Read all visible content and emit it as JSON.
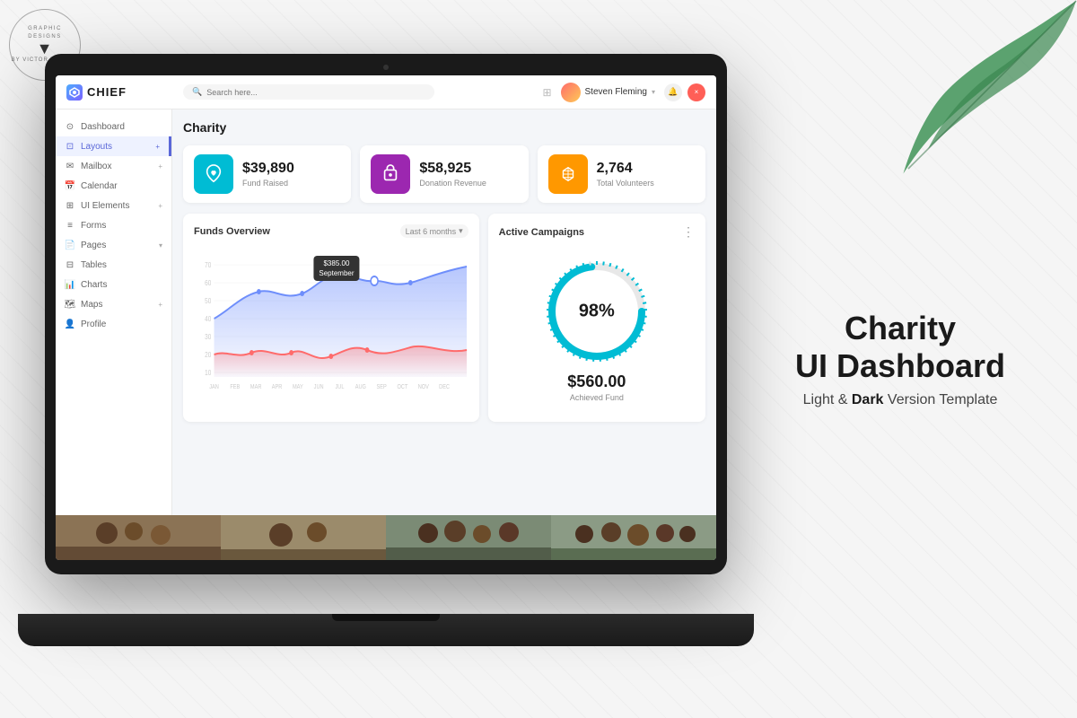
{
  "watermark": {
    "line1": "GRAPHIC DESIGNS",
    "line2": "BY VICTOR THEMES"
  },
  "right_panel": {
    "title1": "Charity",
    "title2": "UI Dashboard",
    "subtitle": "Light & Dark Version Template"
  },
  "topbar": {
    "logo": "CHIEF",
    "search_placeholder": "Search here...",
    "user_name": "Steven Fleming",
    "notification_icon": "🔔",
    "grid_icon": "⊞"
  },
  "sidebar": {
    "items": [
      {
        "label": "Dashboard",
        "icon": "⊙",
        "active": false
      },
      {
        "label": "Layouts",
        "icon": "⊡",
        "active": true,
        "has_arrow": true
      },
      {
        "label": "Mailbox",
        "icon": "✉",
        "active": false,
        "has_arrow": true
      },
      {
        "label": "Calendar",
        "icon": "📅",
        "active": false
      },
      {
        "label": "UI Elements",
        "icon": "⊞",
        "active": false,
        "has_arrow": true
      },
      {
        "label": "Forms",
        "icon": "≡",
        "active": false
      },
      {
        "label": "Pages",
        "icon": "📄",
        "active": false,
        "has_arrow": true
      },
      {
        "label": "Tables",
        "icon": "⊟",
        "active": false
      },
      {
        "label": "Charts",
        "icon": "📊",
        "active": false
      },
      {
        "label": "Maps",
        "icon": "🗺",
        "active": false,
        "has_arrow": true
      },
      {
        "label": "Profile",
        "icon": "👤",
        "active": false
      }
    ]
  },
  "page": {
    "title": "Charity"
  },
  "stats": [
    {
      "value": "$39,890",
      "label": "Fund Raised",
      "icon": "🤲",
      "color_class": "cyan"
    },
    {
      "value": "$58,925",
      "label": "Donation Revenue",
      "icon": "🎁",
      "color_class": "purple"
    },
    {
      "value": "2,764",
      "label": "Total Volunteers",
      "icon": "👥",
      "color_class": "orange"
    }
  ],
  "funds_chart": {
    "title": "Funds Overview",
    "filter": "Last 6 months",
    "tooltip_value": "$385.00",
    "tooltip_month": "September",
    "x_labels": [
      "JAN",
      "FEB",
      "MAR",
      "APR",
      "MAY",
      "JUN",
      "JUL",
      "AUG",
      "SEP",
      "OCT",
      "NOV",
      "DEC"
    ],
    "y_labels": [
      "70",
      "60",
      "50",
      "40",
      "30",
      "20",
      "10"
    ]
  },
  "campaigns_chart": {
    "title": "Active Campaigns",
    "percent": "98%",
    "achieved_value": "$560.00",
    "achieved_label": "Achieved Fund"
  },
  "photos": [
    {
      "alt": "children photo 1"
    },
    {
      "alt": "children photo 2"
    },
    {
      "alt": "children photo 3"
    },
    {
      "alt": "children photo 4"
    }
  ]
}
